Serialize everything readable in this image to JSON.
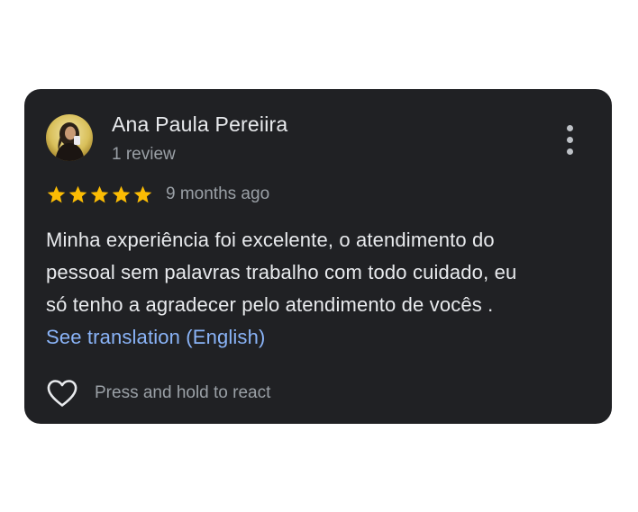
{
  "review": {
    "author_name": "Ana Paula Pereiira",
    "review_count": "1 review",
    "rating": 5,
    "max_rating": 5,
    "time_ago": "9 months ago",
    "text_lines": [
      "Minha experiência foi excelente, o atendimento do",
      "pessoal sem palavras trabalho com todo cuidado, eu",
      "só tenho a agradecer pelo atendimento de vocês ."
    ],
    "translation_link": "See translation (English)",
    "react_hint": "Press and hold to react"
  },
  "icons": {
    "avatar": "user-photo-avatar",
    "more": "more-vert-icon",
    "star": "star-icon",
    "heart": "heart-outline-icon"
  },
  "colors": {
    "card_background": "#202124",
    "primary_text": "#e8eaed",
    "secondary_text": "#9aa0a6",
    "star": "#fbbc04",
    "link": "#8ab4f8"
  }
}
